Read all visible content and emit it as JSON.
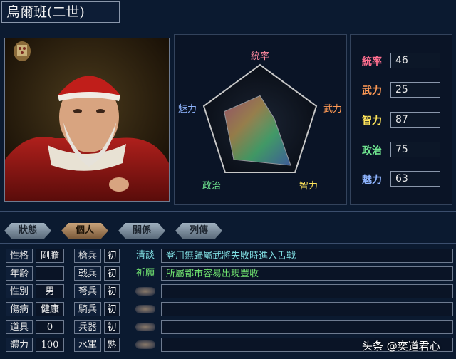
{
  "title": "烏爾班(二世)",
  "radar": {
    "labels": {
      "top": "統率",
      "right": "武力",
      "bottom_right": "智力",
      "bottom_left": "政治",
      "left": "魅力"
    }
  },
  "stats": [
    {
      "label": "統率",
      "value": "46",
      "color": "#ff6f8f"
    },
    {
      "label": "武力",
      "value": "25",
      "color": "#ff9a55"
    },
    {
      "label": "智力",
      "value": "87",
      "color": "#ffe45a"
    },
    {
      "label": "政治",
      "value": "75",
      "color": "#6fe58f"
    },
    {
      "label": "魅力",
      "value": "63",
      "color": "#8fb5ff"
    }
  ],
  "tabs": [
    "狀態",
    "個人",
    "關係",
    "列傳"
  ],
  "active_tab": "個人",
  "profile": [
    {
      "label": "性格",
      "value": "剛膽"
    },
    {
      "label": "年齢",
      "value": "--"
    },
    {
      "label": "性別",
      "value": "男"
    },
    {
      "label": "傷病",
      "value": "健康"
    },
    {
      "label": "道具",
      "value": "0"
    },
    {
      "label": "體力",
      "value": "100"
    }
  ],
  "troops": [
    {
      "label": "槍兵",
      "value": "初"
    },
    {
      "label": "戟兵",
      "value": "初"
    },
    {
      "label": "弩兵",
      "value": "初"
    },
    {
      "label": "騎兵",
      "value": "初"
    },
    {
      "label": "兵器",
      "value": "初"
    },
    {
      "label": "水軍",
      "value": "熟"
    }
  ],
  "skills": [
    {
      "tag": "清談",
      "desc": "登用無歸屬武將失敗時進入舌戰",
      "tag_color": "#7fdce0",
      "desc_color": "#7fdce0"
    },
    {
      "tag": "祈願",
      "desc": "所屬都市容易出現豐收",
      "tag_color": "#6fe06f",
      "desc_color": "#6fe06f"
    }
  ],
  "watermark": "头条 @奕道君心"
}
